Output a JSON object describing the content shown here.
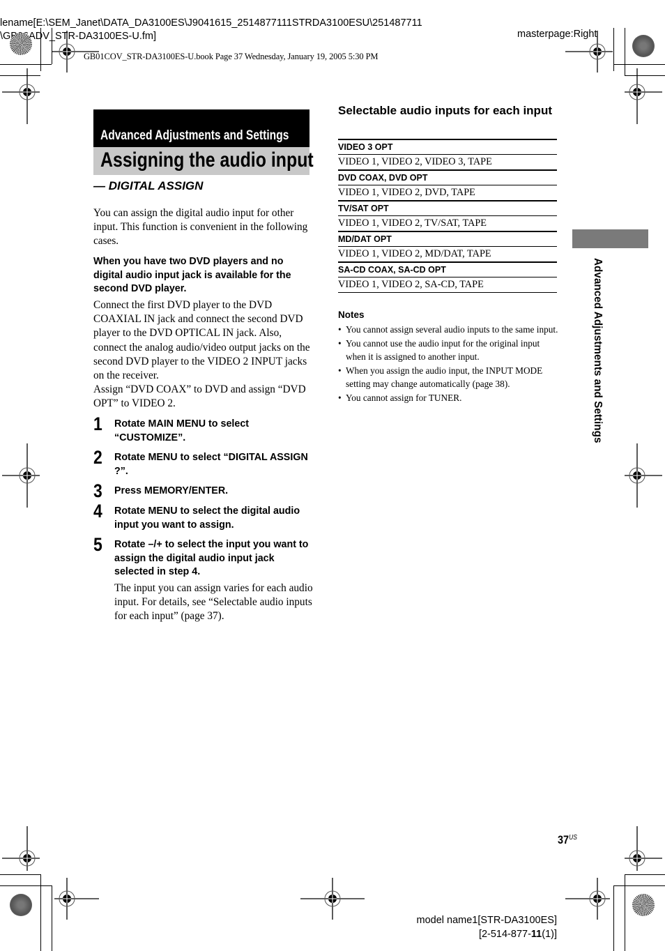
{
  "header": {
    "filename_line1": "lename[E:\\SEM_Janet\\DATA_DA3100ES\\J9041615_2514877111STRDA3100ESU\\251487711",
    "filename_line2": "\\GB06ADV_STR-DA3100ES-U.fm]",
    "masterpage": "masterpage:Right",
    "book_info": "GB01COV_STR-DA3100ES-U.book  Page 37  Wednesday, January 19, 2005  5:30 PM"
  },
  "section": {
    "category": "Advanced Adjustments and Settings",
    "title": "Assigning the audio input",
    "subtitle": "— DIGITAL ASSIGN"
  },
  "intro": "You can assign the digital audio input for other input. This function is convenient in the following cases.",
  "case": {
    "heading": "When you have two DVD players and no digital audio input jack is available for the second DVD player.",
    "body_1": "Connect the first DVD player to the DVD COAXIAL IN jack and connect the second DVD player to the DVD OPTICAL IN jack. Also, connect the analog audio/video output jacks on the second DVD player to the VIDEO 2 INPUT jacks on the receiver.",
    "body_2": "Assign “DVD COAX” to DVD and assign “DVD OPT” to VIDEO 2."
  },
  "steps": [
    {
      "num": "1",
      "text": "Rotate MAIN MENU to select “CUSTOMIZE”."
    },
    {
      "num": "2",
      "text": "Rotate MENU to select “DIGITAL ASSIGN ?”."
    },
    {
      "num": "3",
      "text": "Press MEMORY/ENTER."
    },
    {
      "num": "4",
      "text": "Rotate MENU to select the digital audio input you want to assign."
    },
    {
      "num": "5",
      "text": "Rotate –/+ to select the input you want to assign the digital audio input jack selected in step 4."
    }
  ],
  "step_note": "The input you can assign varies for each audio input. For details, see “Selectable audio inputs for each input” (page 37).",
  "selectable_table": {
    "title": "Selectable audio inputs for each input",
    "rows": [
      {
        "input": "VIDEO 3 OPT",
        "selectable": "VIDEO 1, VIDEO 2, VIDEO 3, TAPE"
      },
      {
        "input": "DVD COAX, DVD OPT",
        "selectable": "VIDEO 1, VIDEO 2, DVD, TAPE"
      },
      {
        "input": "TV/SAT OPT",
        "selectable": "VIDEO 1, VIDEO 2, TV/SAT, TAPE"
      },
      {
        "input": "MD/DAT OPT",
        "selectable": "VIDEO 1, VIDEO 2, MD/DAT, TAPE"
      },
      {
        "input": "SA-CD COAX, SA-CD OPT",
        "selectable": "VIDEO 1, VIDEO 2, SA-CD, TAPE"
      }
    ]
  },
  "notes": {
    "title": "Notes",
    "items": [
      "You cannot assign several audio inputs to the same input.",
      "You cannot use the audio input for the original input when it is assigned to another input.",
      "When you assign the audio input, the INPUT MODE setting may change automatically (page 38).",
      "You cannot assign for TUNER."
    ]
  },
  "side_tab": {
    "label": "Advanced Adjustments and Settings",
    "color": "#7a7a7a"
  },
  "footer": {
    "page_number": "37",
    "page_suffix": "US",
    "model_line1": "model name1[STR-DA3100ES]",
    "model_line2_prefix": "[2-514-877-",
    "model_line2_bold": "11",
    "model_line2_suffix": "(1)]"
  }
}
